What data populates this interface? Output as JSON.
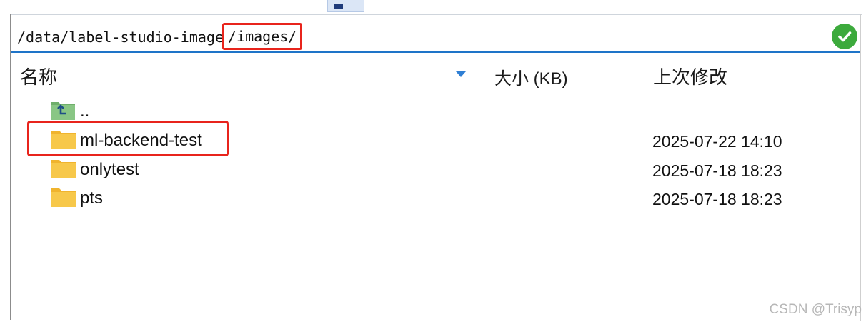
{
  "path_bar": {
    "path_prefix": "/data/label-studio-image",
    "path_highlight": "/images/",
    "status_icon": "check-circle-icon",
    "status_color": "#3caa3c"
  },
  "columns": {
    "name": "名称",
    "size": "大小 (KB)",
    "modified": "上次修改",
    "sort_icon": "sort-descending-icon"
  },
  "files": [
    {
      "name": "..",
      "type": "parent",
      "modified": ""
    },
    {
      "name": "ml-backend-test",
      "type": "folder",
      "modified": "2025-07-22 14:10"
    },
    {
      "name": "onlytest",
      "type": "folder",
      "modified": "2025-07-18 18:23"
    },
    {
      "name": "pts",
      "type": "folder",
      "modified": "2025-07-18 18:23"
    }
  ],
  "watermark": "CSDN @Trisyp",
  "colors": {
    "highlight_border": "#e8241c",
    "folder": "#f7c23e",
    "accent": "#1e74c8"
  }
}
